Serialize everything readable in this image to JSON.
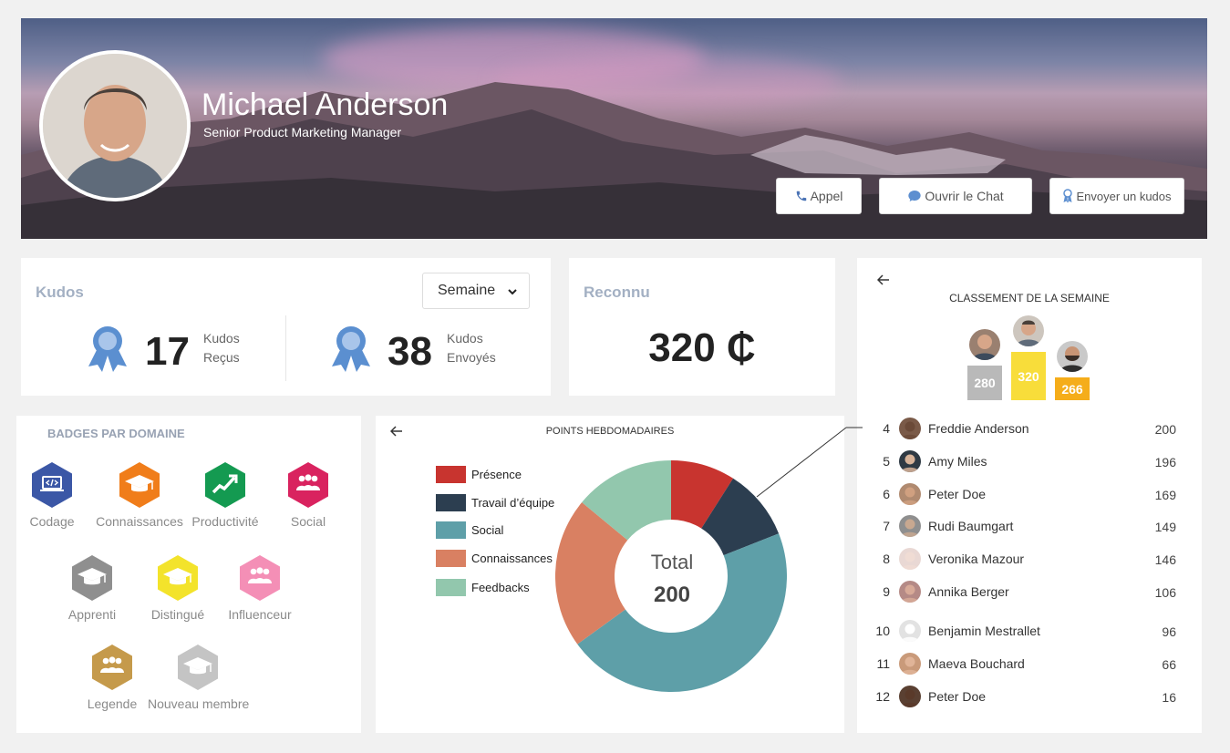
{
  "profile": {
    "name": "Michael Anderson",
    "job_title": "Senior Product Marketing Manager"
  },
  "actions": {
    "call": "Appel",
    "chat": "Ouvrir le Chat",
    "kudos": "Envoyer un kudos"
  },
  "kudos_card": {
    "title": "Kudos",
    "period": "Semaine",
    "received_count": "17",
    "received_l1": "Kudos",
    "received_l2": "Reçus",
    "sent_count": "38",
    "sent_l1": "Kudos",
    "sent_l2": "Envoyés"
  },
  "recognized_card": {
    "title": "Reconnu",
    "value": "320 ₵"
  },
  "badges": {
    "title": "BADGES PAR DOMAINE",
    "items": [
      {
        "label": "Codage",
        "color": "#3b57a6",
        "icon": "laptop-code-icon"
      },
      {
        "label": "Connaissances",
        "color": "#f07d1a",
        "icon": "graduation-cap-icon"
      },
      {
        "label": "Productivité",
        "color": "#149a51",
        "icon": "growth-chart-icon"
      },
      {
        "label": "Social",
        "color": "#d9235f",
        "icon": "people-group-icon"
      },
      {
        "label": "Apprenti",
        "color": "#8f8f8f",
        "icon": "graduation-cap-icon"
      },
      {
        "label": "Distingué",
        "color": "#f3e32b",
        "icon": "graduation-cap-icon"
      },
      {
        "label": "Influenceur",
        "color": "#f48fb6",
        "icon": "people-group-icon"
      },
      {
        "label": "Legende",
        "color": "#c59a4b",
        "icon": "people-group-icon"
      },
      {
        "label": "Nouveau membre",
        "color": "#c4c4c4",
        "icon": "graduation-cap-icon"
      }
    ]
  },
  "weekly_points": {
    "title": "POINTS HEBDOMADAIRES",
    "total_label": "Total",
    "total_value": "200"
  },
  "chart_data": {
    "type": "pie",
    "title": "POINTS HEBDOMADAIRES",
    "categories": [
      "Présence",
      "Travail d'équipe",
      "Social",
      "Connaissances",
      "Feedbacks"
    ],
    "values": [
      9,
      10,
      46,
      21,
      14
    ],
    "colors": [
      "#c8342f",
      "#2c3e50",
      "#5e9fa8",
      "#d98062",
      "#92c7ad"
    ],
    "legend": "left",
    "legend_labels": [
      "Présence",
      "Travail d’équipe",
      "Social",
      "Connaissances",
      "Feedbacks"
    ]
  },
  "leaderboard": {
    "title": "CLASSEMENT DE LA SEMAINE",
    "podium": [
      {
        "points": "280",
        "color": "#b9b9b9"
      },
      {
        "points": "320",
        "color": "#f8dd3a"
      },
      {
        "points": "266",
        "color": "#f5ad1a"
      }
    ],
    "rows": [
      {
        "rank": "4",
        "name": "Freddie Anderson",
        "points": "200"
      },
      {
        "rank": "5",
        "name": "Amy Miles",
        "points": "196"
      },
      {
        "rank": "6",
        "name": "Peter Doe",
        "points": "169"
      },
      {
        "rank": "7",
        "name": "Rudi Baumgart",
        "points": "149"
      },
      {
        "rank": "8",
        "name": "Veronika Mazour",
        "points": "146"
      },
      {
        "rank": "9",
        "name": "Annika Berger",
        "points": "106"
      },
      {
        "rank": "10",
        "name": "Benjamin Mestrallet",
        "points": "96"
      },
      {
        "rank": "11",
        "name": "Maeva Bouchard",
        "points": "66"
      },
      {
        "rank": "12",
        "name": "Peter Doe",
        "points": "16"
      }
    ]
  }
}
